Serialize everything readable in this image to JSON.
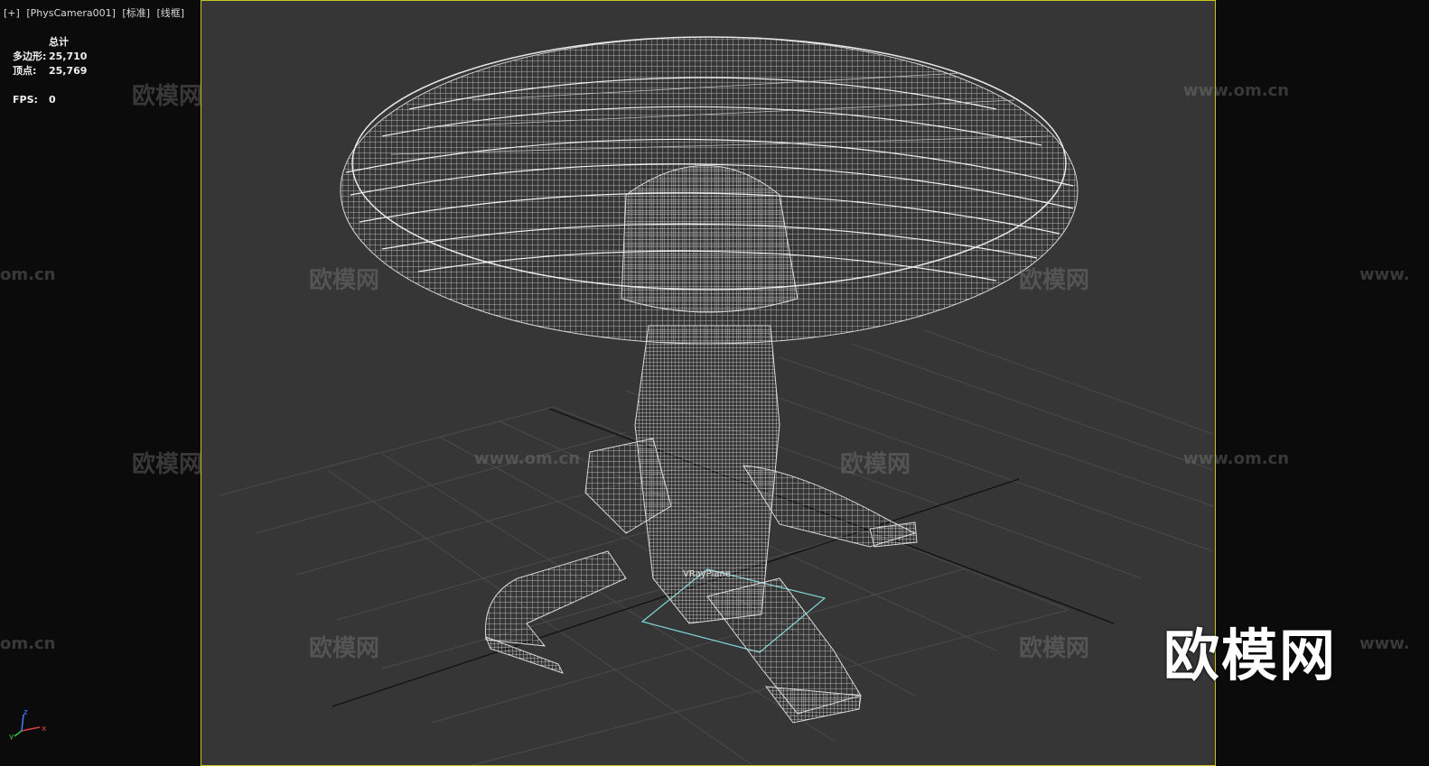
{
  "viewport": {
    "menu": "[+]",
    "camera": "[PhysCamera001]",
    "shading_standard": "[标准]",
    "shading_mode": "[线框]"
  },
  "stats": {
    "total_label": "总计",
    "polygons_label": "多边形:",
    "polygons_value": "25,710",
    "vertices_label": "顶点:",
    "vertices_value": "25,769",
    "fps_label": "FPS:",
    "fps_value": "0"
  },
  "scene": {
    "object_label": "VRayPlane"
  },
  "watermark": {
    "brand": "欧模网",
    "url": "www.om.cn",
    "url_partial": "om.cn",
    "url_prefix": "www."
  },
  "axis": {
    "x": "x",
    "y": "y",
    "z": "z"
  },
  "colors": {
    "viewport_bg": "#363636",
    "frame_border": "#c9c51f",
    "wire": "#d9d9d9",
    "plane": "#7fd6d6"
  }
}
